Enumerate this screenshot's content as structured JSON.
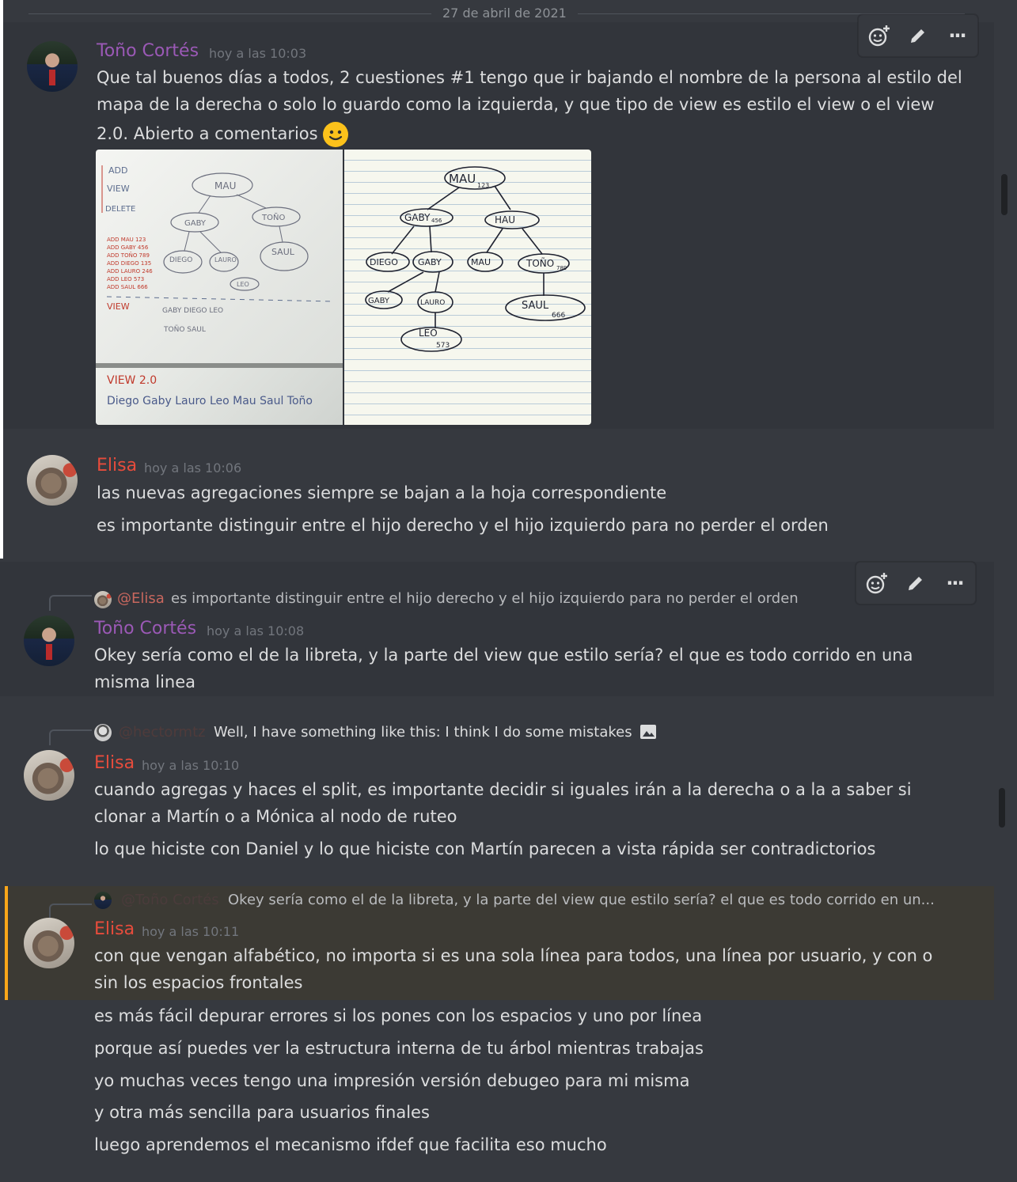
{
  "date_divider": "27 de abril de 2021",
  "toolbar": {
    "add_reaction_icon": "add-reaction-icon",
    "edit_icon": "pencil-icon",
    "more_icon": "more-icon",
    "more_label": "···"
  },
  "messages": {
    "m1": {
      "author": "Toño Cortés",
      "timestamp": "hoy a las 10:03",
      "lines": [
        "Que tal buenos días a todos, 2 cuestiones #1 tengo que ir bajando el nombre de la persona al estilo del",
        "mapa de la derecha o solo lo guardo como la izquierda, y que tipo de view es estilo el view o el view",
        "2.0. Abierto a comentarios"
      ],
      "attachment": {
        "whiteboard": {
          "sidebar": [
            "ADD",
            "VIEW",
            "DELETE"
          ],
          "root": "MAU",
          "nodes": [
            "GABY",
            "TOÑO",
            "DIEGO",
            "LAURO",
            "SAUL",
            "LEO"
          ],
          "adds": [
            "ADD MAU 123",
            "ADD GABY 456",
            "ADD TOÑO 789",
            "ADD DIEGO 135",
            "ADD LAURO 246",
            "ADD LEO 573",
            "ADD SAUL 666"
          ],
          "view_label": "VIEW",
          "view2_label": "VIEW 2.0",
          "view2_line": "Diego Gaby Lauro Leo Mau Saul Toño"
        },
        "notebook": {
          "nodes": [
            "MAU",
            "GABY",
            "HAU",
            "DIEGO",
            "GABY",
            "MAU",
            "TOÑO",
            "GABY",
            "LAURO",
            "SAUL",
            "LEO"
          ],
          "values": [
            "123",
            "456",
            "135",
            "789",
            "666",
            "573"
          ]
        }
      }
    },
    "m2": {
      "author": "Elisa",
      "timestamp": "hoy a las 10:06",
      "lines": [
        "las nuevas agregaciones siempre se bajan a la hoja correspondiente",
        "es importante distinguir entre el hijo derecho y el hijo izquierdo para no perder el orden"
      ]
    },
    "m3": {
      "reply_mention": "@Elisa",
      "reply_text": "es importante distinguir entre el hijo derecho y el hijo izquierdo para no perder el orden",
      "author": "Toño Cortés",
      "timestamp": "hoy a las 10:08",
      "lines": [
        "Okey sería como el de la libreta, y la parte del view que estilo sería? el que es todo corrido en una",
        "misma linea"
      ]
    },
    "m4": {
      "reply_mention": "@hectormtz",
      "reply_text": "Well, I have something like this: I think I do some mistakes",
      "author": "Elisa",
      "timestamp": "hoy a las 10:10",
      "lines": [
        "cuando agregas y haces el split, es importante decidir si iguales irán a la derecha o a la a saber si",
        "clonar a Martín o a Mónica al nodo de ruteo",
        "lo que hiciste con Daniel y lo que hiciste con Martín parecen a vista rápida ser contradictorios"
      ]
    },
    "m5": {
      "reply_mention": "@Toño Cortés",
      "reply_text": "Okey sería como el de la libreta, y la parte del view que estilo sería? el que es todo corrido en un...",
      "author": "Elisa",
      "timestamp": "hoy a las 10:11",
      "lines": [
        "con que vengan alfabético, no importa si es una sola línea para todos, una línea por usuario, y con o",
        "sin los espacios frontales",
        "es más fácil depurar errores si los pones con los espacios y uno por línea",
        "porque así puedes ver la estructura interna de tu árbol mientras trabajas",
        "yo muchas veces tengo una impresión versión debugeo para mi misma",
        "y otra más sencilla para usuarios finales",
        "luego aprendemos el mecanismo ifdef que facilita eso mucho"
      ]
    }
  },
  "colors": {
    "background": "#36393f",
    "tono_name": "#9b59b6",
    "elisa_name": "#e74c3c",
    "mention_highlight": "#faa61a",
    "timestamp": "#72767d"
  }
}
